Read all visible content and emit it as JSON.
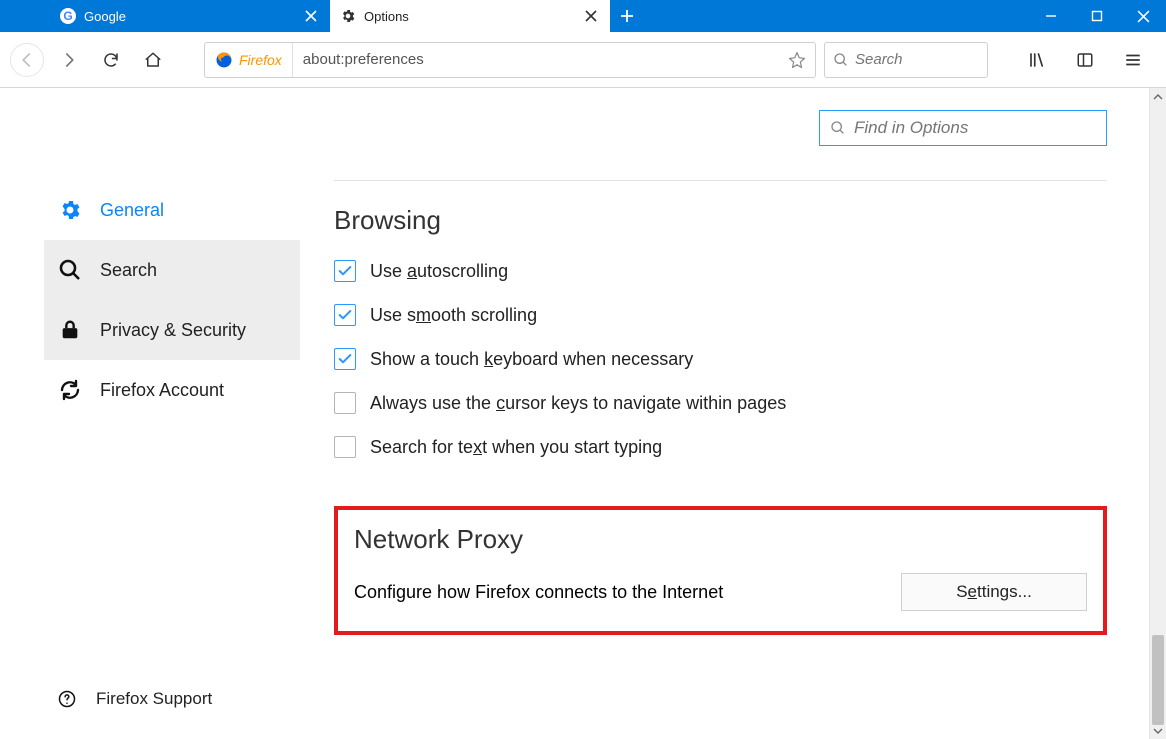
{
  "tabs": {
    "google": "Google",
    "options": "Options"
  },
  "urlbar": {
    "identity": "Firefox",
    "value": "about:preferences"
  },
  "searchbox": {
    "placeholder": "Search"
  },
  "find": {
    "placeholder": "Find in Options"
  },
  "sidebar": {
    "general": "General",
    "search": "Search",
    "privacy": "Privacy & Security",
    "account": "Firefox Account"
  },
  "support": "Firefox Support",
  "browsing": {
    "title": "Browsing",
    "autoscroll_pre": "Use ",
    "autoscroll_u": "a",
    "autoscroll_post": "utoscrolling",
    "smooth_pre": "Use s",
    "smooth_u": "m",
    "smooth_post": "ooth scrolling",
    "touch_pre": "Show a touch ",
    "touch_u": "k",
    "touch_post": "eyboard when necessary",
    "cursor_pre": "Always use the ",
    "cursor_u": "c",
    "cursor_post": "ursor keys to navigate within pages",
    "text_pre": "Search for te",
    "text_u": "x",
    "text_post": "t when you start typing"
  },
  "proxy": {
    "title": "Network Proxy",
    "desc": "Configure how Firefox connects to the Internet",
    "btn_pre": "S",
    "btn_u": "e",
    "btn_post": "ttings..."
  }
}
